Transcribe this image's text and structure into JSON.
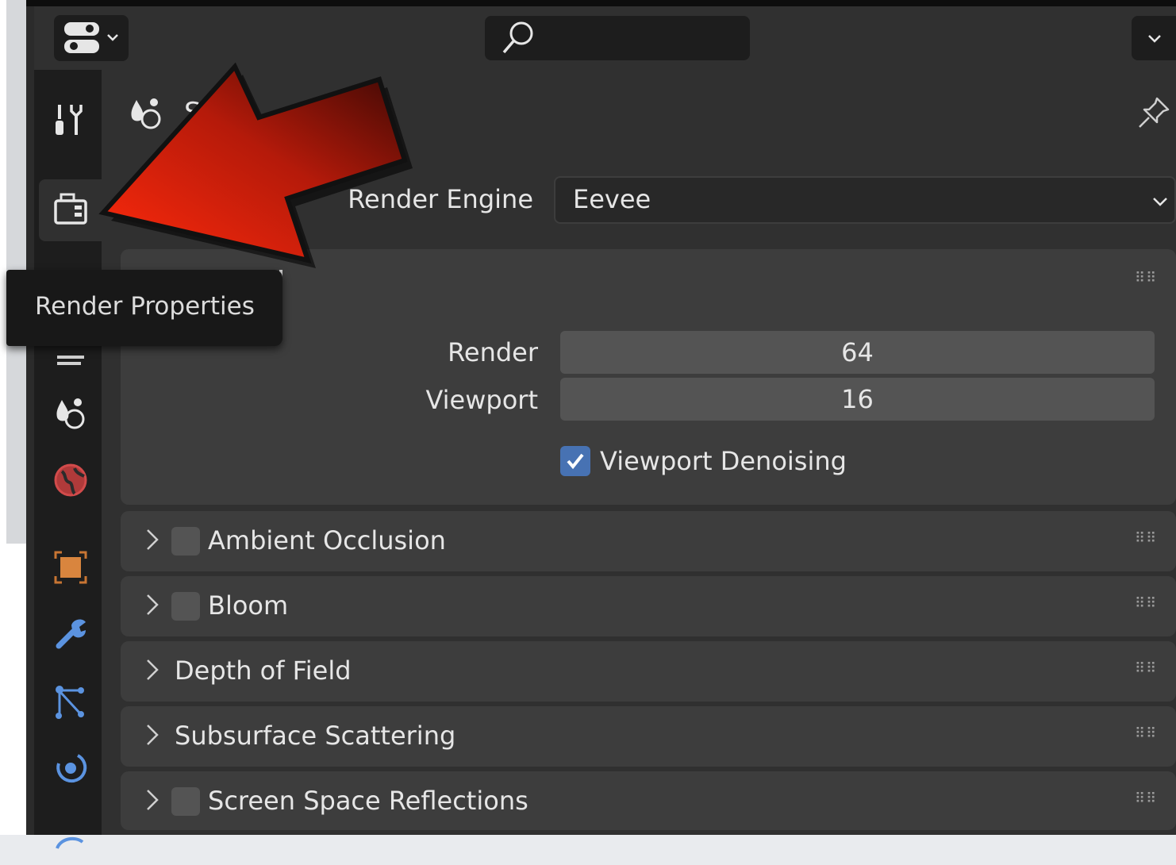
{
  "tooltip": {
    "text": "Render Properties"
  },
  "context": {
    "title_partial": "S"
  },
  "render_engine": {
    "label": "Render Engine",
    "value": "Eevee"
  },
  "sampling": {
    "render_label": "Render",
    "render_value": "64",
    "viewport_label": "Viewport",
    "viewport_value": "16",
    "denoise_label": "Viewport Denoising",
    "denoise_checked": true
  },
  "panels": [
    {
      "title": "Ambient Occlusion",
      "has_checkbox": true
    },
    {
      "title": "Bloom",
      "has_checkbox": true
    },
    {
      "title": "Depth of Field",
      "has_checkbox": false
    },
    {
      "title": "Subsurface Scattering",
      "has_checkbox": false
    },
    {
      "title": "Screen Space Reflections",
      "has_checkbox": true
    }
  ],
  "tabs": [
    "tool-icon",
    "render-icon",
    "output-icon",
    "view-layer-icon",
    "scene-icon",
    "world-icon",
    "object-icon",
    "modifier-icon",
    "particles-icon",
    "physics-icon",
    "constraint-icon"
  ],
  "colors": {
    "accent": "#4772b3",
    "arrow_red": "#e8220f",
    "panel_bg": "#3d3d3d",
    "field_bg": "#545454"
  }
}
